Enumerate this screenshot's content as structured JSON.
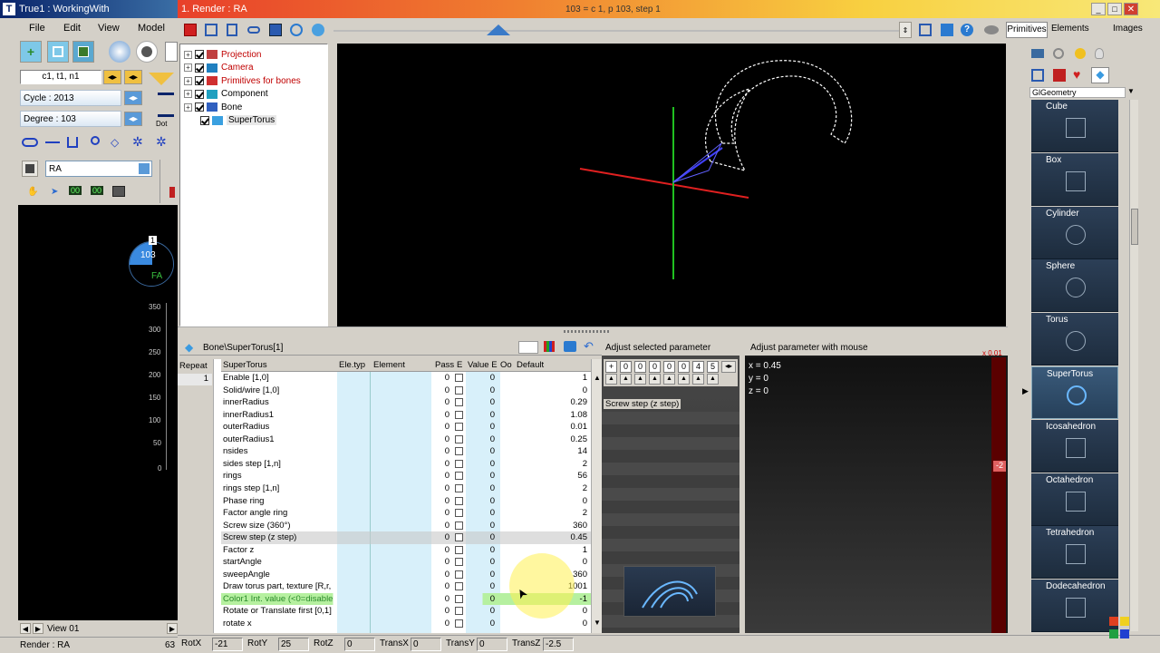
{
  "app": {
    "left_title": "True1 : WorkingWith",
    "render_title": "1. Render : RA",
    "render_status": "103 = c 1, p 103, step 1",
    "render_label": "Render : RA",
    "render_code": "63"
  },
  "menu": [
    "File",
    "Edit",
    "View",
    "Model"
  ],
  "left_panel": {
    "cycle_code": "c1, t1, n1",
    "cycle": "Cycle : 2013",
    "degree": "Degree : 103",
    "dot": "Dot",
    "name_value": "RA",
    "counters": [
      "00",
      "00"
    ],
    "dial_top": "1",
    "dial_value": "103",
    "dial_label": "FA",
    "scale": [
      "350",
      "300",
      "250",
      "200",
      "150",
      "100",
      "50",
      "0"
    ],
    "view": "View 01"
  },
  "tree": [
    {
      "label": "Projection",
      "color": "#c00000",
      "indent": 0,
      "checked": true,
      "icon": "#c04040"
    },
    {
      "label": "Camera",
      "color": "#c00000",
      "indent": 0,
      "checked": true,
      "icon": "#2080c0"
    },
    {
      "label": "Primitives for bones",
      "color": "#c00000",
      "indent": 0,
      "checked": true,
      "icon": "#d03030"
    },
    {
      "label": "Component",
      "color": "#000000",
      "indent": 0,
      "checked": true,
      "icon": "#20a0c0"
    },
    {
      "label": "Bone",
      "color": "#000000",
      "indent": 0,
      "checked": true,
      "icon": "#3060c0"
    },
    {
      "label": "SuperTorus",
      "color": "#000000",
      "indent": 1,
      "checked": true,
      "icon": "#3aa0e0"
    }
  ],
  "right_tabs": [
    "Primitives",
    "Elements",
    "Images"
  ],
  "geometry_header": "GlGeometry",
  "primitives": [
    "Cube",
    "Box",
    "Cylinder",
    "Sphere",
    "Torus",
    "SuperTorus",
    "Icosahedron",
    "Octahedron",
    "Tetrahedron",
    "Dodecahedron"
  ],
  "params": {
    "path": "Bone\\SuperTorus[1]",
    "repeat_label": "Repeat",
    "repeat_value": "1",
    "columns": [
      "SuperTorus",
      "Ele.typ",
      "Element",
      "Pass",
      "E",
      "Value E",
      "Oo",
      "Default"
    ],
    "rows": [
      {
        "name": "Enable [1,0]",
        "pass": "0",
        "value": "0",
        "default": "1"
      },
      {
        "name": "Solid/wire [1,0]",
        "pass": "0",
        "value": "0",
        "default": "0"
      },
      {
        "name": "innerRadius",
        "pass": "0",
        "value": "0",
        "default": "0.29"
      },
      {
        "name": "innerRadius1",
        "pass": "0",
        "value": "0",
        "default": "1.08"
      },
      {
        "name": "outerRadius",
        "pass": "0",
        "value": "0",
        "default": "0.01"
      },
      {
        "name": "outerRadius1",
        "pass": "0",
        "value": "0",
        "default": "0.25"
      },
      {
        "name": "nsides",
        "pass": "0",
        "value": "0",
        "default": "14"
      },
      {
        "name": "sides step [1,n]",
        "pass": "0",
        "value": "0",
        "default": "2"
      },
      {
        "name": "rings",
        "pass": "0",
        "value": "0",
        "default": "56"
      },
      {
        "name": "rings step [1,n]",
        "pass": "0",
        "value": "0",
        "default": "2"
      },
      {
        "name": "Phase ring",
        "pass": "0",
        "value": "0",
        "default": "0"
      },
      {
        "name": "Factor angle ring",
        "pass": "0",
        "value": "0",
        "default": "2"
      },
      {
        "name": "Screw size (360°)",
        "pass": "0",
        "value": "0",
        "default": "360"
      },
      {
        "name": "Screw step (z step)",
        "pass": "0",
        "value": "0",
        "default": "0.45"
      },
      {
        "name": "Factor z",
        "pass": "0",
        "value": "0",
        "default": "1"
      },
      {
        "name": "startAngle",
        "pass": "0",
        "value": "0",
        "default": "0"
      },
      {
        "name": "sweepAngle",
        "pass": "0",
        "value": "0",
        "default": "360"
      },
      {
        "name": "Draw torus part, texture  [R,r,",
        "pass": "0",
        "value": "0",
        "default": "1001"
      },
      {
        "name": "Color1 Int. value (<0=disable",
        "pass": "0",
        "value": "0",
        "default": "-1"
      },
      {
        "name": "Rotate or Translate first [0,1]",
        "pass": "0",
        "value": "0",
        "default": "0"
      },
      {
        "name": "rotate x",
        "pass": "0",
        "value": "0",
        "default": "0"
      }
    ]
  },
  "adjust": {
    "title": "Adjust selected parameter",
    "digits": [
      "+",
      "0",
      "0",
      "0",
      "0",
      "0",
      "4",
      "5"
    ],
    "param_name": "Screw step (z step)"
  },
  "mouse_adjust": {
    "title": "Adjust parameter with mouse",
    "scale": "x 0.01",
    "x": "x = 0.45",
    "y": "y = 0",
    "z": "z = 0",
    "marker": "-2"
  },
  "status_bar": [
    {
      "label": "RotX",
      "value": "-21"
    },
    {
      "label": "RotY",
      "value": "25"
    },
    {
      "label": "RotZ",
      "value": "0"
    },
    {
      "label": "TransX",
      "value": "0"
    },
    {
      "label": "TransY",
      "value": "0"
    },
    {
      "label": "TransZ",
      "value": "-2.5"
    }
  ],
  "colors": {
    "accent_blue": "#0a246a",
    "render_title_grad": "#e8402a",
    "highlight_green": "#b6f0a0",
    "selected_row": "#d8d8d8"
  }
}
